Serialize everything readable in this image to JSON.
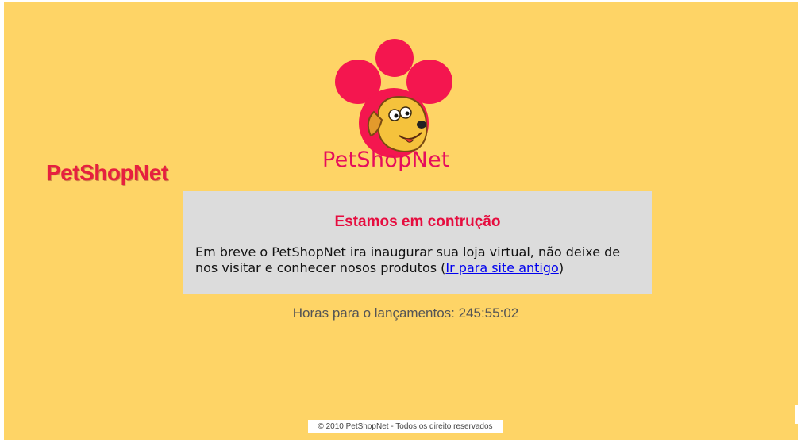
{
  "side_brand": {
    "text": "PetShopNet"
  },
  "logo": {
    "text": "PetShopNet",
    "image": "paw-dog-logo-icon"
  },
  "notice": {
    "title": "Estamos em contrução",
    "body_prefix": "Em breve o PetShopNet ira inaugurar sua loja virtual, não deixe de nos visitar e conhecer nosos produtos (",
    "link_label": "Ir para site antigo",
    "body_suffix": ")"
  },
  "countdown": {
    "text": "Horas para o lançamentos: 245:55:02"
  },
  "footer": {
    "text": "© 2010 PetShopNet - Todos os direito reservados"
  },
  "colors": {
    "background": "#fed466",
    "brand_red": "#e6203f",
    "logo_pink": "#e60d5c",
    "notice_bg": "#dcdcdc",
    "link": "#0000ee"
  }
}
